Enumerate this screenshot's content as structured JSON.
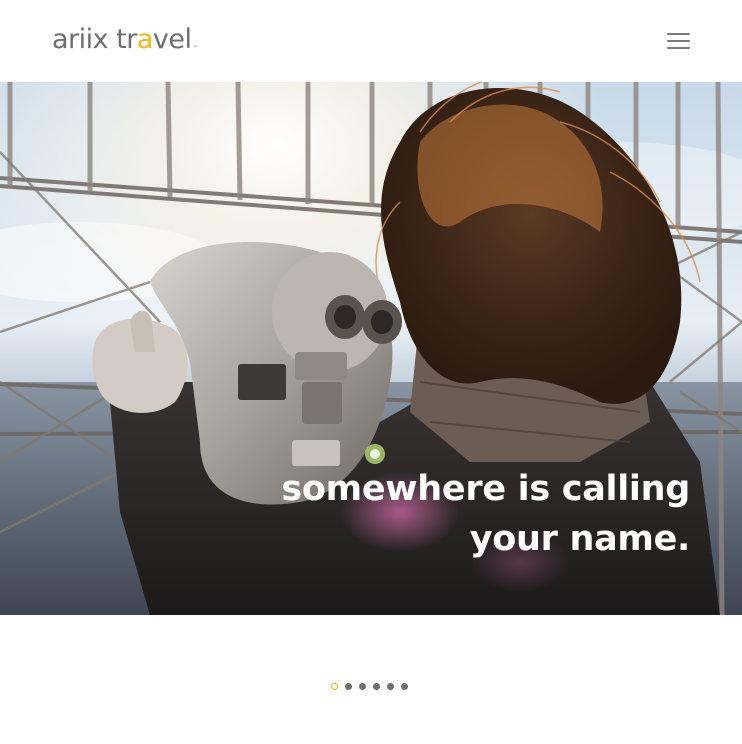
{
  "header": {
    "logo": {
      "brand": "ariix",
      "accent_prefix": "tr",
      "accent": "a",
      "accent_suffix": "vel",
      "trademark": "™",
      "accent_color": "#f3b61f",
      "text_color": "#6f6f6f"
    },
    "menu_icon": "hamburger-menu-icon"
  },
  "hero": {
    "image_subject": "woman with windblown hair looking through coin-operated binoculars at city skyline",
    "headline_line1": "somewhere is calling",
    "headline_line2": "your name."
  },
  "carousel": {
    "total_slides": 6,
    "active_index": 0,
    "active_color": "#f3b61f",
    "inactive_color": "#6e6e6e"
  }
}
